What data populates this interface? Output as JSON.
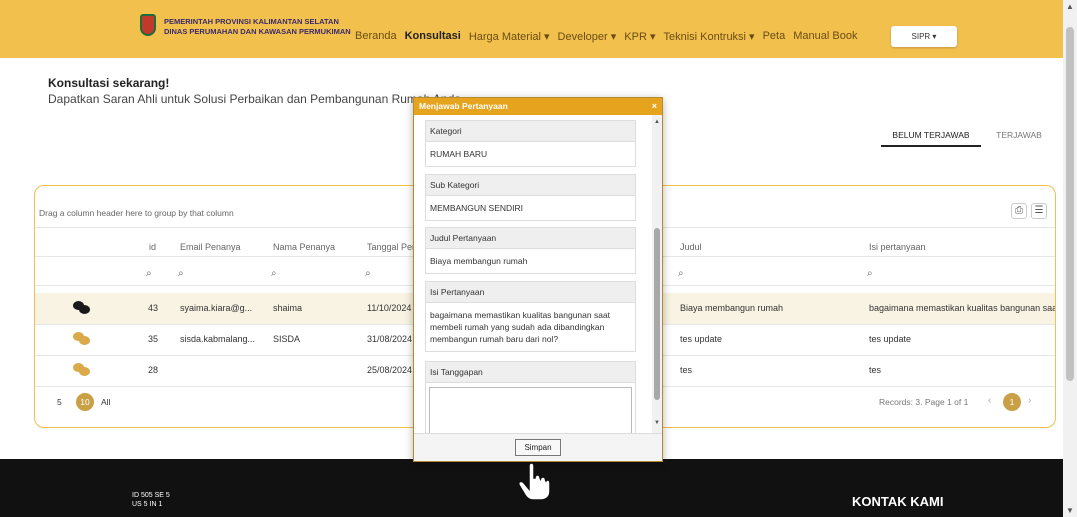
{
  "header": {
    "brand_line1": "PEMERINTAH PROVINSI KALIMANTAN SELATAN",
    "brand_line2": "DINAS PERUMAHAN DAN KAWASAN PERMUKIMAN",
    "nav": [
      {
        "label": "Beranda"
      },
      {
        "label": "Konsultasi"
      },
      {
        "label": "Harga Material ▾"
      },
      {
        "label": "Developer ▾"
      },
      {
        "label": "KPR ▾"
      },
      {
        "label": "Teknisi Kontruksi ▾"
      },
      {
        "label": "Peta"
      },
      {
        "label": "Manual Book"
      }
    ],
    "user_menu": "SIPR ▾"
  },
  "intro": {
    "title": "Konsultasi sekarang!",
    "subtitle": "Dapatkan Saran Ahli untuk Solusi Perbaikan dan Pembangunan Rumah Anda"
  },
  "tabs": [
    {
      "label": "BELUM TERJAWAB",
      "active": true
    },
    {
      "label": "TERJAWAB",
      "active": false
    }
  ],
  "grid": {
    "group_hint": "Drag a column header here to group by that column",
    "columns": {
      "id": "id",
      "email": "Email Penanya",
      "nama": "Nama Penanya",
      "tanggal": "Tanggal Per",
      "judul": "Judul",
      "isi": "Isi pertanyaan"
    },
    "rows": [
      {
        "id": "43",
        "email": "syaima.kiara@g...",
        "nama": "shaima",
        "tanggal": "11/10/2024",
        "judul": "Biaya membangun rumah",
        "isi": "bagaimana memastikan kualitas bangunan saat"
      },
      {
        "id": "35",
        "email": "sisda.kabmalang...",
        "nama": "SISDA",
        "tanggal": "31/08/2024",
        "judul": "tes update",
        "isi": "tes update"
      },
      {
        "id": "28",
        "email": "",
        "nama": "",
        "tanggal": "25/08/2024",
        "judul": "tes",
        "isi": "tes"
      }
    ],
    "page_sizes": [
      "5",
      "10",
      "All"
    ],
    "records": "Records: 3. Page 1 of 1",
    "current_page": "1"
  },
  "modal": {
    "title": "Menjawab Pertanyaan",
    "close": "×",
    "kategori_label": "Kategori",
    "kategori_value": "RUMAH BARU",
    "subkategori_label": "Sub Kategori",
    "subkategori_value": "MEMBANGUN SENDIRI",
    "judul_label": "Judul Pertanyaan",
    "judul_value": "Biaya membangun rumah",
    "isi_label": "Isi Pertanyaan",
    "isi_value": "bagaimana memastikan kualitas bangunan saat membeli rumah yang sudah ada dibandingkan membangun rumah baru dari nol?",
    "tanggapan_label": "Isi Tanggapan",
    "save_label": "Simpan"
  },
  "footer": {
    "stats_line1": "ID 505 SE 5",
    "stats_line2": "US 5 IN 1",
    "kontak": "KONTAK KAMI"
  },
  "icons": {
    "chat_dark": "#1a1a1a",
    "chat_light": "#d9a94a",
    "accent": "#f2c04d"
  }
}
